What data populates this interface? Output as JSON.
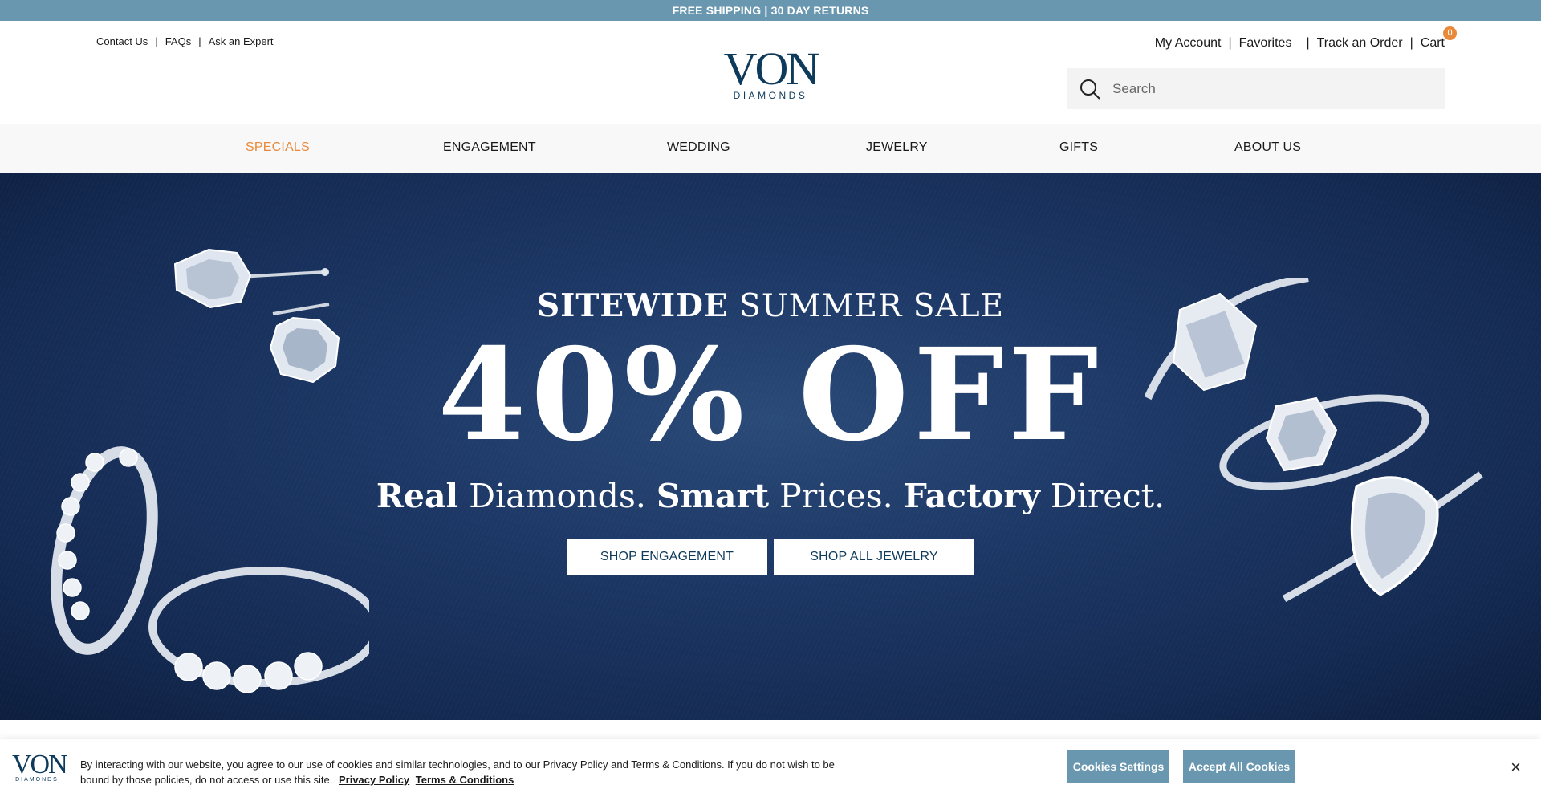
{
  "announcement": "FREE SHIPPING | 30 DAY RETURNS",
  "utility_left": [
    "Contact Us",
    "FAQs",
    "Ask an Expert"
  ],
  "utility_right": {
    "my_account": "My Account",
    "favorites": "Favorites",
    "track_order": "Track an Order",
    "cart": "Cart",
    "cart_count": "0"
  },
  "logo": {
    "main": "VON",
    "sub": "DIAMONDS"
  },
  "search": {
    "placeholder": "Search"
  },
  "nav": [
    "SPECIALS",
    "ENGAGEMENT",
    "WEDDING",
    "JEWELRY",
    "GIFTS",
    "ABOUT US"
  ],
  "hero": {
    "top_bold": "SITEWIDE",
    "top_rest": " SUMMER SALE",
    "big": "40% OFF",
    "tag": [
      {
        "bold": "Real",
        "rest": " Diamonds. "
      },
      {
        "bold": "Smart",
        "rest": " Prices. "
      },
      {
        "bold": "Factory",
        "rest": " Direct."
      }
    ],
    "btn_engagement": "SHOP ENGAGEMENT",
    "btn_jewelry": "SHOP ALL JEWELRY"
  },
  "cookie": {
    "logo_main": "VON",
    "logo_sub": "DIAMONDS",
    "text": "By interacting with our website, you agree to our use of cookies and similar technologies, and to our Privacy Policy and Terms & Conditions. If you do not wish to be bound by those policies, do not access or use this site.",
    "privacy_link": "Privacy Policy",
    "terms_link": "Terms & Conditions",
    "settings_btn": "Cookies Settings",
    "accept_btn": "Accept All Cookies",
    "close": "×"
  },
  "colors": {
    "accent": "#e98a3b",
    "brand_blue": "#0e3a5b",
    "bar_blue": "#6a97b0"
  },
  "icons": [
    "search-icon",
    "close-icon"
  ]
}
